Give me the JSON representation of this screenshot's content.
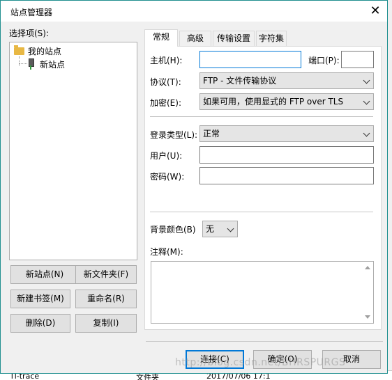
{
  "dialog": {
    "title": "站点管理器",
    "close_symbol": "✕"
  },
  "left": {
    "label": "选择项(S):",
    "tree": {
      "root": "我的站点",
      "child": "新站点"
    },
    "buttons": {
      "new_site": "新站点(N)",
      "new_folder": "新文件夹(F)",
      "new_bookmark": "新建书签(M)",
      "rename": "重命名(R)",
      "delete": "删除(D)",
      "copy": "复制(I)"
    }
  },
  "tabs": [
    "常规",
    "高级",
    "传输设置",
    "字符集"
  ],
  "general": {
    "host_label": "主机(H):",
    "host_value": "",
    "port_label": "端口(P):",
    "port_value": "",
    "protocol_label": "协议(T):",
    "protocol_value": "FTP - 文件传输协议",
    "encryption_label": "加密(E):",
    "encryption_value": "如果可用，使用显式的 FTP over TLS",
    "logon_type_label": "登录类型(L):",
    "logon_type_value": "正常",
    "user_label": "用户(U):",
    "user_value": "",
    "password_label": "密码(W):",
    "password_value": "",
    "bg_color_label": "背景颜色(B)",
    "bg_color_value": "无",
    "comments_label": "注释(M):"
  },
  "footer": {
    "connect": "连接(C)",
    "ok": "确定(O)",
    "cancel": "取消"
  },
  "watermark": "http://blog.csdn.net/BHRSPURGS",
  "background_app": {
    "row_name": "Tl-trace",
    "row_type": "文件夹",
    "row_date": "2017/07/06 17:1"
  },
  "colors": {
    "accent": "#0078d7",
    "border": "#1f8f8f"
  }
}
